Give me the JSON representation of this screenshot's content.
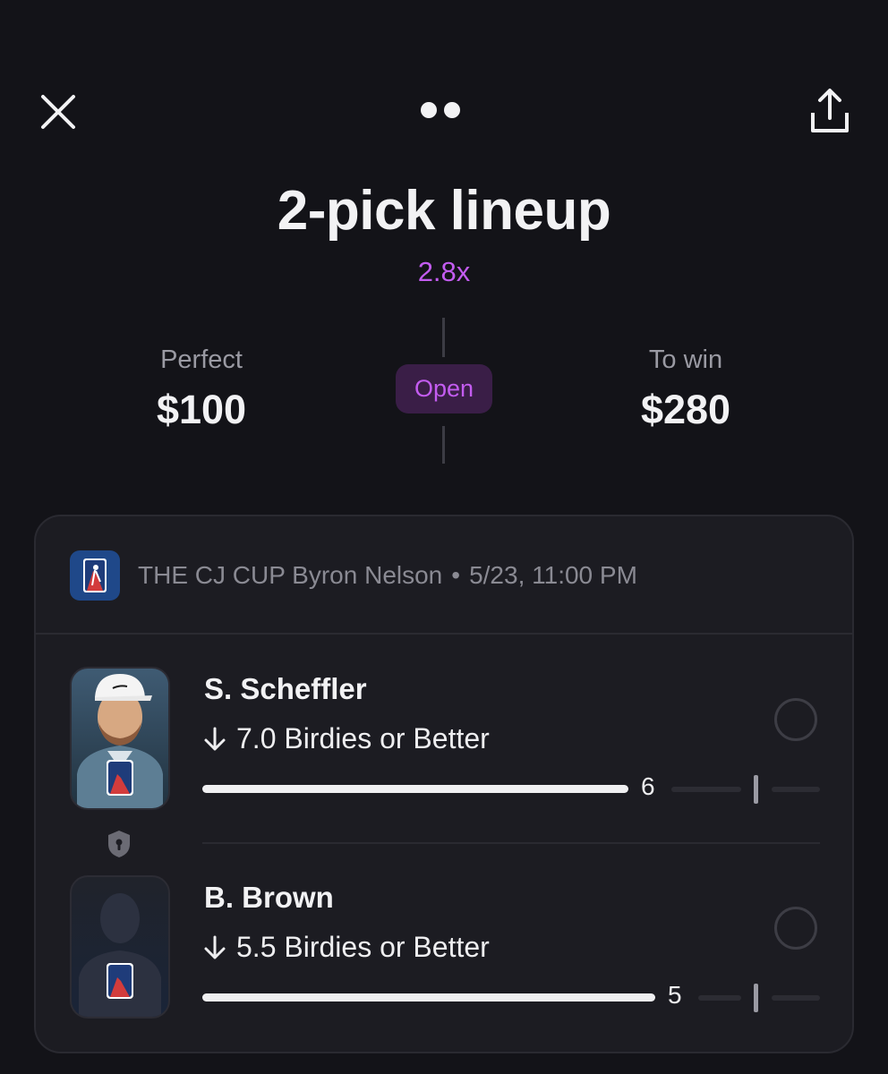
{
  "header": {
    "title": "2-pick lineup",
    "multiplier": "2.8x"
  },
  "stats": {
    "entry_label": "Perfect",
    "entry_value": "$100",
    "status": "Open",
    "win_label": "To win",
    "win_value": "$280"
  },
  "event": {
    "league_icon": "pga-tour-logo",
    "name": "THE CJ CUP Byron Nelson",
    "separator": "•",
    "datetime": "5/23, 11:00 PM"
  },
  "picks": [
    {
      "player": "S. Scheffler",
      "direction": "lower",
      "line": "7.0 Birdies or Better",
      "current_value": "6"
    },
    {
      "player": "B. Brown",
      "direction": "lower",
      "line": "5.5 Birdies or Better",
      "current_value": "5"
    }
  ],
  "colors": {
    "background": "#131318",
    "card": "#1c1c22",
    "accent": "#c35cf0",
    "status_pill": "#3a1e47"
  }
}
